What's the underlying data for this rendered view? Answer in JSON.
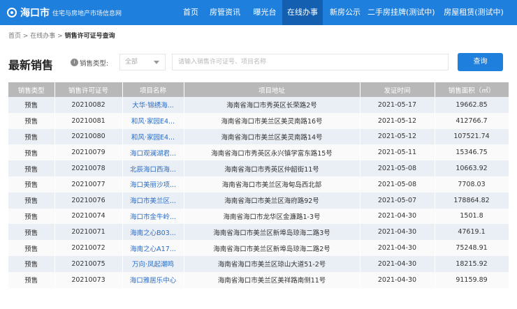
{
  "site": {
    "name": "海口市",
    "subtitle": "住宅与房地产市场信息网"
  },
  "nav": [
    {
      "label": "首页"
    },
    {
      "label": "房管资讯"
    },
    {
      "label": "曝光台"
    },
    {
      "label": "在线办事",
      "active": true
    },
    {
      "label": "新房公示"
    },
    {
      "label": "二手房挂牌(测试中)"
    },
    {
      "label": "房屋租赁(测试中)"
    }
  ],
  "breadcrumb": {
    "home": "首页",
    "sep1": " > ",
    "level1": "在线办事",
    "sep2": " > ",
    "current": "销售许可证号查询"
  },
  "section": {
    "title": "最新销售",
    "filter_icon": "i",
    "filter_label": "销售类型:",
    "filter_value": "全部",
    "search_placeholder": "请输入销售许可证号、项目名称",
    "query_button": "查询"
  },
  "table": {
    "columns": [
      "销售类型",
      "销售许可证号",
      "项目名称",
      "项目地址",
      "发证时间",
      "销售面积（㎡）"
    ],
    "rows": [
      [
        "预售",
        "20210082",
        "大华·锦绣海...",
        "海南省海口市秀英区长荣路2号",
        "2021-05-17",
        "19662.85"
      ],
      [
        "预售",
        "20210081",
        "和风·家园E4...",
        "海南省海口市美兰区美灵南路16号",
        "2021-05-12",
        "412766.7"
      ],
      [
        "预售",
        "20210080",
        "和风·家园E4...",
        "海南省海口市美兰区美灵南路14号",
        "2021-05-12",
        "107521.74"
      ],
      [
        "预售",
        "20210079",
        "海口观澜湖君...",
        "海南省海口市秀英区永兴镇学富东路15号",
        "2021-05-11",
        "15346.75"
      ],
      [
        "预售",
        "20210078",
        "北辰海口西海...",
        "海南省海口市秀英区仲韶街11号",
        "2021-05-08",
        "10663.92"
      ],
      [
        "预售",
        "20210077",
        "海口美丽沙项...",
        "海南省海口市美兰区海甸岛西北部",
        "2021-05-08",
        "7708.03"
      ],
      [
        "预售",
        "20210076",
        "海口市美兰区...",
        "海南省海口市美兰区海府路92号",
        "2021-05-07",
        "178864.82"
      ],
      [
        "预售",
        "20210074",
        "海口市金牛岭...",
        "海南省海口市龙华区金濂路1-3号",
        "2021-04-30",
        "1501.8"
      ],
      [
        "预售",
        "20210071",
        "海南之心B03...",
        "海南省海口市美兰区新埠岛琼海二路3号",
        "2021-04-30",
        "47619.1"
      ],
      [
        "预售",
        "20210072",
        "海南之心A17...",
        "海南省海口市美兰区新埠岛琼海二路2号",
        "2021-04-30",
        "75248.91"
      ],
      [
        "预售",
        "20210075",
        "万向·凤起潮鸣",
        "海南省海口市美兰区琼山大道51-2号",
        "2021-04-30",
        "18215.92"
      ],
      [
        "预售",
        "20210073",
        "海口雅居乐中心",
        "海南省海口市美兰区美祥路南侧11号",
        "2021-04-30",
        "91159.89"
      ]
    ]
  },
  "colors": {
    "brand": "#1e7fdd",
    "nav_active": "#145fb0",
    "header_bg": "#b8b8b8",
    "link": "#2a6ec7",
    "row_odd": "#eaeef5",
    "row_even": "#fafafa"
  }
}
